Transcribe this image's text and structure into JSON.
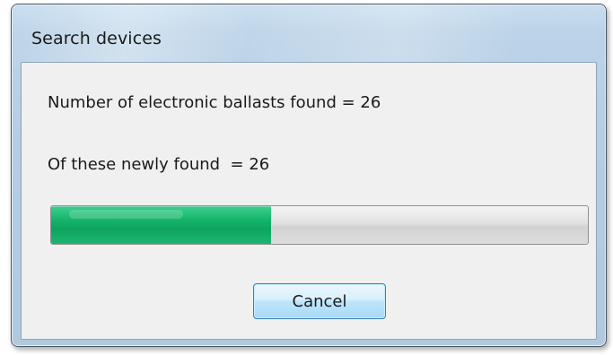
{
  "dialog": {
    "title": "Search devices",
    "ballasts_found_text": "Number of electronic ballasts found = 26",
    "newly_found_text": "Of these newly found  = 26",
    "progress_fraction": 0.41,
    "cancel_label": "Cancel"
  },
  "colors": {
    "progress_fill": "#16b56c",
    "progress_track": "#dcdcdc",
    "button_border": "#3c7fb1"
  }
}
